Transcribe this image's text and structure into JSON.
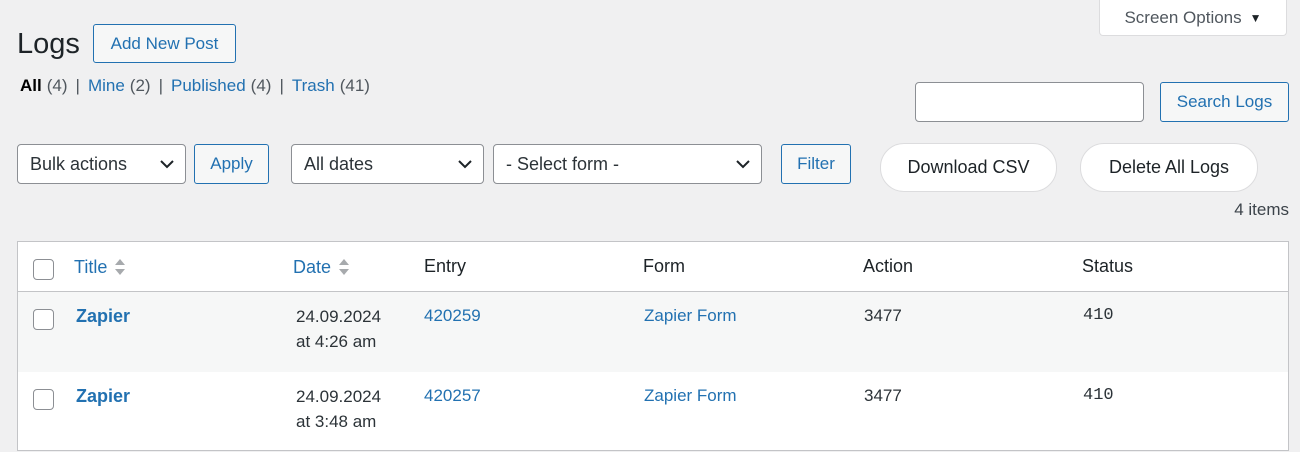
{
  "screen_options": {
    "label": "Screen Options",
    "caret": "▼"
  },
  "header": {
    "title": "Logs",
    "add_new_label": "Add New Post"
  },
  "views": [
    {
      "label": "All",
      "count": "(4)"
    },
    {
      "label": "Mine",
      "count": "(2)"
    },
    {
      "label": "Published",
      "count": "(4)"
    },
    {
      "label": "Trash",
      "count": "(41)"
    }
  ],
  "search": {
    "value": "",
    "button_label": "Search Logs"
  },
  "filters": {
    "bulk_actions": "Bulk actions",
    "apply_label": "Apply",
    "dates": "All dates",
    "form": "- Select form -",
    "filter_label": "Filter"
  },
  "actions": {
    "download_csv": "Download CSV",
    "delete_all": "Delete All Logs"
  },
  "items_count": "4 items",
  "table": {
    "columns": [
      "Title",
      "Date",
      "Entry",
      "Form",
      "Action",
      "Status"
    ],
    "rows": [
      {
        "title": "Zapier",
        "date": "24.09.2024",
        "time": "at 4:26 am",
        "entry": "420259",
        "form": "Zapier Form",
        "action": "3477",
        "status": "410"
      },
      {
        "title": "Zapier",
        "date": "24.09.2024",
        "time": "at 3:48 am",
        "entry": "420257",
        "form": "Zapier Form",
        "action": "3477",
        "status": "410"
      }
    ]
  },
  "colors": {
    "link": "#2271b1",
    "background": "#f0f0f1",
    "border": "#c3c4c7"
  }
}
